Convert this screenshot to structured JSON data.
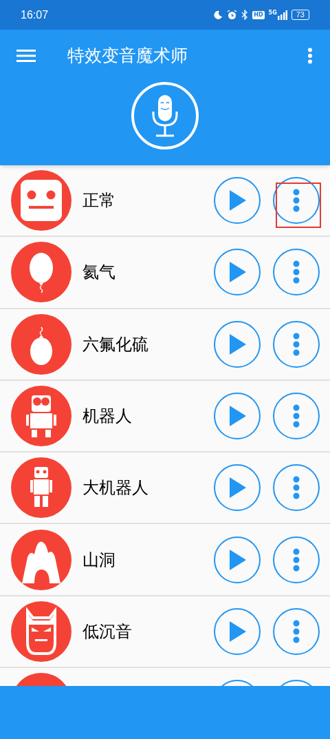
{
  "status_bar": {
    "time": "16:07",
    "hd": "HD",
    "network": "5G",
    "battery": "73"
  },
  "app_bar": {
    "title": "特效变音魔术师"
  },
  "effects": [
    {
      "kind": "face",
      "name": "正常",
      "highlighted": true
    },
    {
      "kind": "balloon",
      "name": "氦气",
      "highlighted": false
    },
    {
      "kind": "gas-balloon",
      "name": "六氟化硫",
      "highlighted": false
    },
    {
      "kind": "robot",
      "name": "机器人",
      "highlighted": false
    },
    {
      "kind": "big-robot",
      "name": "大机器人",
      "highlighted": false
    },
    {
      "kind": "cave",
      "name": "山洞",
      "highlighted": false
    },
    {
      "kind": "devil",
      "name": "低沉音",
      "highlighted": false
    },
    {
      "kind": "blank",
      "highlighted": false
    }
  ]
}
